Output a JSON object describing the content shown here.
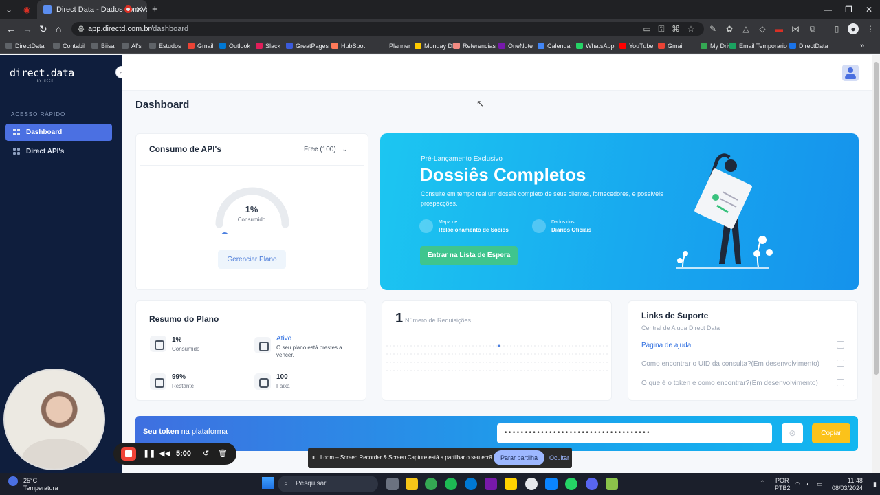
{
  "browser": {
    "tab_title": "Direct Data - Dados com Va",
    "tab_close": "✕",
    "new_tab": "+",
    "url_host": "app.directd.com.br",
    "url_path": "/dashboard",
    "window_controls": [
      "—",
      "❐",
      "✕"
    ],
    "bookmarks": [
      {
        "label": "DirectData",
        "color": "#5f6368"
      },
      {
        "label": "Contabil",
        "color": "#5f6368"
      },
      {
        "label": "Biisa",
        "color": "#5f6368"
      },
      {
        "label": "AI's",
        "color": "#5f6368"
      },
      {
        "label": "Estudos",
        "color": "#5f6368"
      },
      {
        "label": "Gmail",
        "color": "#ea4335"
      },
      {
        "label": "Outlook",
        "color": "#0078d4"
      },
      {
        "label": "Slack",
        "color": "#e01e5a"
      },
      {
        "label": "GreatPages",
        "color": "#3b5bdb"
      },
      {
        "label": "HubSpot",
        "color": "#ff7a59"
      },
      {
        "label": "Planner",
        "color": "#35363a"
      },
      {
        "label": "Monday DD",
        "color": "#ffcb00"
      },
      {
        "label": "Referencias",
        "color": "#f28b82"
      },
      {
        "label": "OneNote",
        "color": "#7719aa"
      },
      {
        "label": "Calendar",
        "color": "#4285f4"
      },
      {
        "label": "WhatsApp",
        "color": "#25d366"
      },
      {
        "label": "YouTube",
        "color": "#ff0000"
      },
      {
        "label": "Gmail",
        "color": "#ea4335"
      },
      {
        "label": "My Drive",
        "color": "#34a853"
      },
      {
        "label": "Email Temporario",
        "color": "#1aa260"
      },
      {
        "label": "DirectData",
        "color": "#1a73e8"
      }
    ],
    "more_bookmarks": "»"
  },
  "sidebar": {
    "logo": "direct.data",
    "logo_sub": "BY ECCE",
    "collapse_icon": "←",
    "section": "ACESSO RÁPIDO",
    "items": [
      {
        "label": "Dashboard",
        "active": true
      },
      {
        "label": "Direct API's",
        "active": false
      }
    ]
  },
  "page": {
    "title": "Dashboard"
  },
  "api_card": {
    "title": "Consumo de API's",
    "plan_select": "Free (100)",
    "gauge_value": "1%",
    "gauge_label": "Consumido",
    "gauge_fraction": 0.01,
    "button": "Gerenciar Plano"
  },
  "promo": {
    "kicker": "Pré-Lançamento Exclusivo",
    "headline": "Dossiês Completos",
    "description": "Consulte em tempo real um dossiê completo de seus clientes, fornecedores, e possíveis prospecções.",
    "features": [
      {
        "line1": "Mapa de",
        "line2": "Relacionamento de Sócios"
      },
      {
        "line1": "Dados dos",
        "line2": "Diários Oficiais"
      }
    ],
    "cta": "Entrar na Lista de Espera"
  },
  "plan_summary": {
    "title": "Resumo do Plano",
    "stats": [
      {
        "value": "1%",
        "label": "Consumido"
      },
      {
        "value": "Ativo",
        "label": "O seu plano está prestes a vencer."
      },
      {
        "value": "99%",
        "label": "Restante"
      },
      {
        "value": "100",
        "label": "Faixa"
      }
    ]
  },
  "requests_card": {
    "count": "1",
    "label": "Número de Requisições"
  },
  "support": {
    "title": "Links de Suporte",
    "subtitle": "Central de Ajuda Direct Data",
    "links": [
      {
        "label": "Página de ajuda",
        "primary": true
      },
      {
        "label": "Como encontrar o UID da consulta?(Em desenvolvimento)",
        "primary": false
      },
      {
        "label": "O que é o token e como encontrar?(Em desenvolvimento)",
        "primary": false
      }
    ]
  },
  "token": {
    "label_bold": "Seu token",
    "label_rest": " na plataforma",
    "masked": "••••••••••••••••••••••••••••••••••••",
    "copy": "Copiar"
  },
  "recorder": {
    "time": "5:00"
  },
  "loom": {
    "message": "Loom – Screen Recorder & Screen Capture está a partilhar o seu ecrã.",
    "share_button": "Parar partilha",
    "hide_button": "Ocultar"
  },
  "taskbar": {
    "weather_temp": "25°C",
    "weather_label": "Temperatura",
    "search_placeholder": "Pesquisar",
    "lang": "POR",
    "lang_sub": "PTB2",
    "time": "11:48",
    "date": "08/03/2024"
  }
}
